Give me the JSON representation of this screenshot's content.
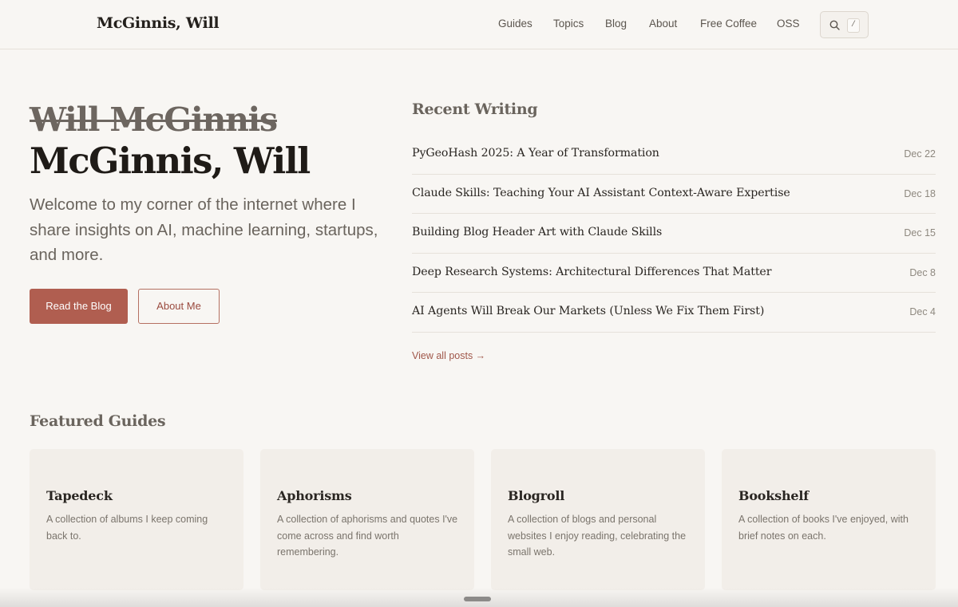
{
  "header": {
    "brand": "McGinnis, Will",
    "nav": [
      {
        "label": "Guides"
      },
      {
        "label": "Topics"
      },
      {
        "label": "Blog"
      },
      {
        "label": "About"
      },
      {
        "label": "Free Coffee"
      },
      {
        "label": "OSS"
      }
    ],
    "search_shortcut": "/"
  },
  "hero": {
    "struck_name": "Will McGinnis",
    "name": "McGinnis, Will",
    "intro": "Welcome to my corner of the internet where I share insights on AI, machine learning, startups, and more.",
    "primary_button": "Read the Blog",
    "secondary_button": "About Me"
  },
  "recent": {
    "title": "Recent Writing",
    "posts": [
      {
        "title": "PyGeoHash 2025: A Year of Transformation",
        "date": "Dec 22"
      },
      {
        "title": "Claude Skills: Teaching Your AI Assistant Context-Aware Expertise",
        "date": "Dec 18"
      },
      {
        "title": "Building Blog Header Art with Claude Skills",
        "date": "Dec 15"
      },
      {
        "title": "Deep Research Systems: Architectural Differences That Matter",
        "date": "Dec 8"
      },
      {
        "title": "AI Agents Will Break Our Markets (Unless We Fix Them First)",
        "date": "Dec 4"
      }
    ],
    "view_all": "View all posts →"
  },
  "guides": {
    "title": "Featured Guides",
    "cards": [
      {
        "title": "Tapedeck",
        "desc": "A collection of albums I keep coming back to."
      },
      {
        "title": "Aphorisms",
        "desc": "A collection of aphorisms and quotes I've come across and find worth remembering."
      },
      {
        "title": "Blogroll",
        "desc": "A collection of blogs and personal websites I enjoy reading, celebrating the small web."
      },
      {
        "title": "Bookshelf",
        "desc": "A collection of books I've enjoyed, with brief notes on each."
      }
    ]
  },
  "colors": {
    "background": "#f8f6f3",
    "accent": "#b05e50",
    "card": "#f2eee9"
  }
}
